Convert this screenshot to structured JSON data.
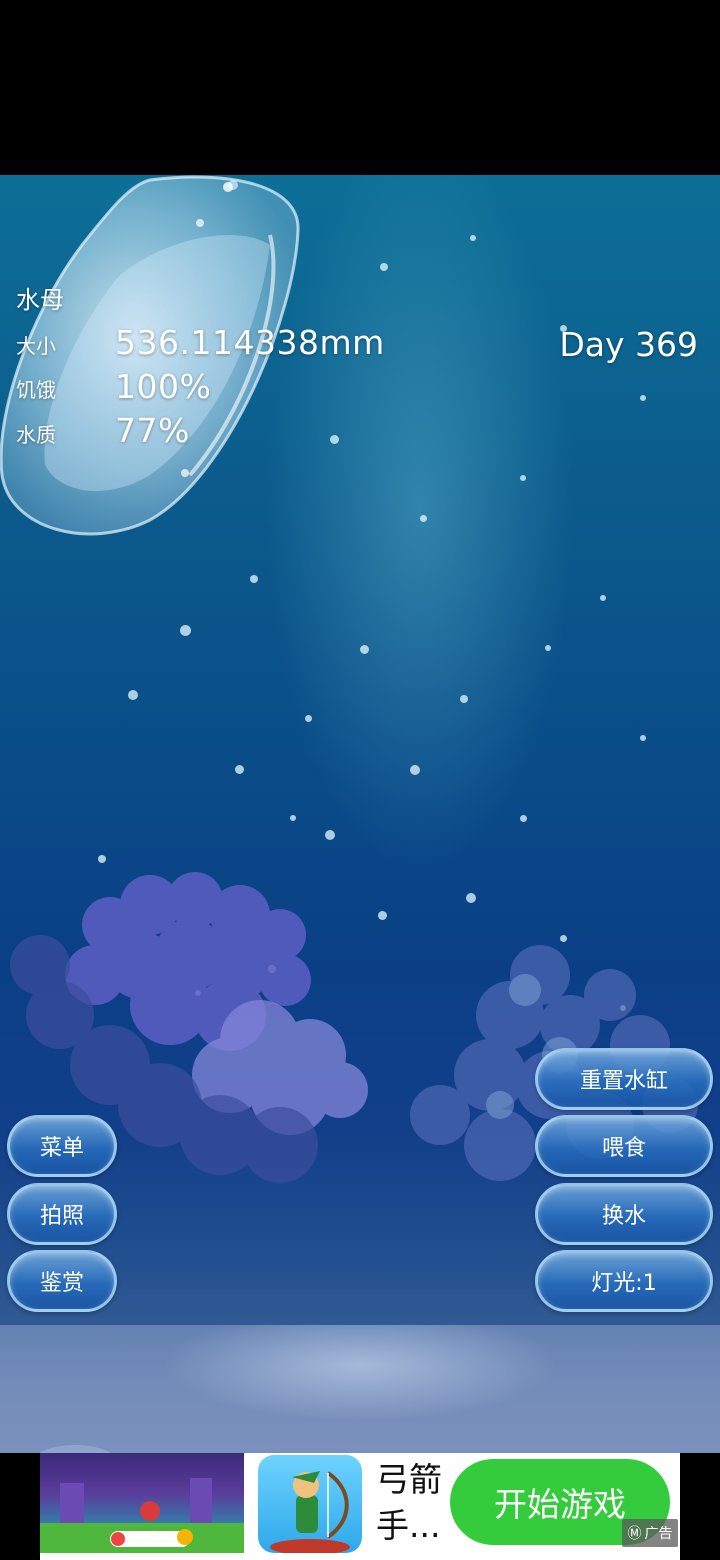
{
  "creature": {
    "name": "水母",
    "stats": [
      {
        "label": "大小",
        "value": "536.114338mm"
      },
      {
        "label": "饥饿",
        "value": "100%"
      },
      {
        "label": "水质",
        "value": "77%"
      }
    ],
    "day": "Day 369"
  },
  "left_buttons": [
    {
      "label": "菜单"
    },
    {
      "label": "拍照"
    },
    {
      "label": "鉴赏"
    }
  ],
  "right_buttons": [
    {
      "label": "重置水缸"
    },
    {
      "label": "喂食"
    },
    {
      "label": "换水"
    },
    {
      "label": "灯光:1"
    }
  ],
  "ad": {
    "app_name": "弓箭手...",
    "cta": "开始游戏",
    "badge": "广告",
    "badge_icon": "m-logo-icon"
  },
  "colors": {
    "water_top": "#0d6f97",
    "water_deep": "#0a3f86",
    "button_border": "#aad7f5",
    "cta_green": "#34cc3c"
  }
}
